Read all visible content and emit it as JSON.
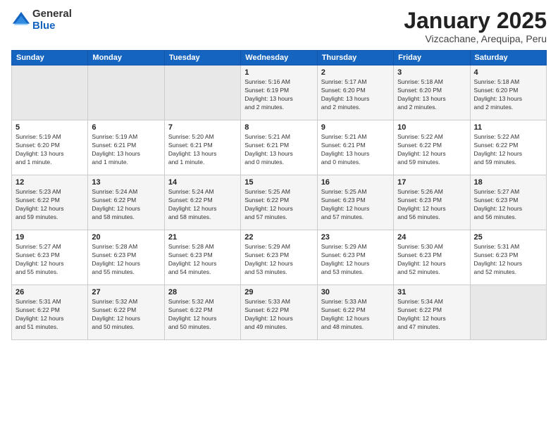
{
  "logo": {
    "general": "General",
    "blue": "Blue"
  },
  "title": "January 2025",
  "subtitle": "Vizcachane, Arequipa, Peru",
  "days_of_week": [
    "Sunday",
    "Monday",
    "Tuesday",
    "Wednesday",
    "Thursday",
    "Friday",
    "Saturday"
  ],
  "weeks": [
    [
      {
        "num": "",
        "info": ""
      },
      {
        "num": "",
        "info": ""
      },
      {
        "num": "",
        "info": ""
      },
      {
        "num": "1",
        "info": "Sunrise: 5:16 AM\nSunset: 6:19 PM\nDaylight: 13 hours\nand 2 minutes."
      },
      {
        "num": "2",
        "info": "Sunrise: 5:17 AM\nSunset: 6:20 PM\nDaylight: 13 hours\nand 2 minutes."
      },
      {
        "num": "3",
        "info": "Sunrise: 5:18 AM\nSunset: 6:20 PM\nDaylight: 13 hours\nand 2 minutes."
      },
      {
        "num": "4",
        "info": "Sunrise: 5:18 AM\nSunset: 6:20 PM\nDaylight: 13 hours\nand 2 minutes."
      }
    ],
    [
      {
        "num": "5",
        "info": "Sunrise: 5:19 AM\nSunset: 6:20 PM\nDaylight: 13 hours\nand 1 minute."
      },
      {
        "num": "6",
        "info": "Sunrise: 5:19 AM\nSunset: 6:21 PM\nDaylight: 13 hours\nand 1 minute."
      },
      {
        "num": "7",
        "info": "Sunrise: 5:20 AM\nSunset: 6:21 PM\nDaylight: 13 hours\nand 1 minute."
      },
      {
        "num": "8",
        "info": "Sunrise: 5:21 AM\nSunset: 6:21 PM\nDaylight: 13 hours\nand 0 minutes."
      },
      {
        "num": "9",
        "info": "Sunrise: 5:21 AM\nSunset: 6:21 PM\nDaylight: 13 hours\nand 0 minutes."
      },
      {
        "num": "10",
        "info": "Sunrise: 5:22 AM\nSunset: 6:22 PM\nDaylight: 12 hours\nand 59 minutes."
      },
      {
        "num": "11",
        "info": "Sunrise: 5:22 AM\nSunset: 6:22 PM\nDaylight: 12 hours\nand 59 minutes."
      }
    ],
    [
      {
        "num": "12",
        "info": "Sunrise: 5:23 AM\nSunset: 6:22 PM\nDaylight: 12 hours\nand 59 minutes."
      },
      {
        "num": "13",
        "info": "Sunrise: 5:24 AM\nSunset: 6:22 PM\nDaylight: 12 hours\nand 58 minutes."
      },
      {
        "num": "14",
        "info": "Sunrise: 5:24 AM\nSunset: 6:22 PM\nDaylight: 12 hours\nand 58 minutes."
      },
      {
        "num": "15",
        "info": "Sunrise: 5:25 AM\nSunset: 6:22 PM\nDaylight: 12 hours\nand 57 minutes."
      },
      {
        "num": "16",
        "info": "Sunrise: 5:25 AM\nSunset: 6:23 PM\nDaylight: 12 hours\nand 57 minutes."
      },
      {
        "num": "17",
        "info": "Sunrise: 5:26 AM\nSunset: 6:23 PM\nDaylight: 12 hours\nand 56 minutes."
      },
      {
        "num": "18",
        "info": "Sunrise: 5:27 AM\nSunset: 6:23 PM\nDaylight: 12 hours\nand 56 minutes."
      }
    ],
    [
      {
        "num": "19",
        "info": "Sunrise: 5:27 AM\nSunset: 6:23 PM\nDaylight: 12 hours\nand 55 minutes."
      },
      {
        "num": "20",
        "info": "Sunrise: 5:28 AM\nSunset: 6:23 PM\nDaylight: 12 hours\nand 55 minutes."
      },
      {
        "num": "21",
        "info": "Sunrise: 5:28 AM\nSunset: 6:23 PM\nDaylight: 12 hours\nand 54 minutes."
      },
      {
        "num": "22",
        "info": "Sunrise: 5:29 AM\nSunset: 6:23 PM\nDaylight: 12 hours\nand 53 minutes."
      },
      {
        "num": "23",
        "info": "Sunrise: 5:29 AM\nSunset: 6:23 PM\nDaylight: 12 hours\nand 53 minutes."
      },
      {
        "num": "24",
        "info": "Sunrise: 5:30 AM\nSunset: 6:23 PM\nDaylight: 12 hours\nand 52 minutes."
      },
      {
        "num": "25",
        "info": "Sunrise: 5:31 AM\nSunset: 6:23 PM\nDaylight: 12 hours\nand 52 minutes."
      }
    ],
    [
      {
        "num": "26",
        "info": "Sunrise: 5:31 AM\nSunset: 6:22 PM\nDaylight: 12 hours\nand 51 minutes."
      },
      {
        "num": "27",
        "info": "Sunrise: 5:32 AM\nSunset: 6:22 PM\nDaylight: 12 hours\nand 50 minutes."
      },
      {
        "num": "28",
        "info": "Sunrise: 5:32 AM\nSunset: 6:22 PM\nDaylight: 12 hours\nand 50 minutes."
      },
      {
        "num": "29",
        "info": "Sunrise: 5:33 AM\nSunset: 6:22 PM\nDaylight: 12 hours\nand 49 minutes."
      },
      {
        "num": "30",
        "info": "Sunrise: 5:33 AM\nSunset: 6:22 PM\nDaylight: 12 hours\nand 48 minutes."
      },
      {
        "num": "31",
        "info": "Sunrise: 5:34 AM\nSunset: 6:22 PM\nDaylight: 12 hours\nand 47 minutes."
      },
      {
        "num": "",
        "info": ""
      }
    ]
  ]
}
